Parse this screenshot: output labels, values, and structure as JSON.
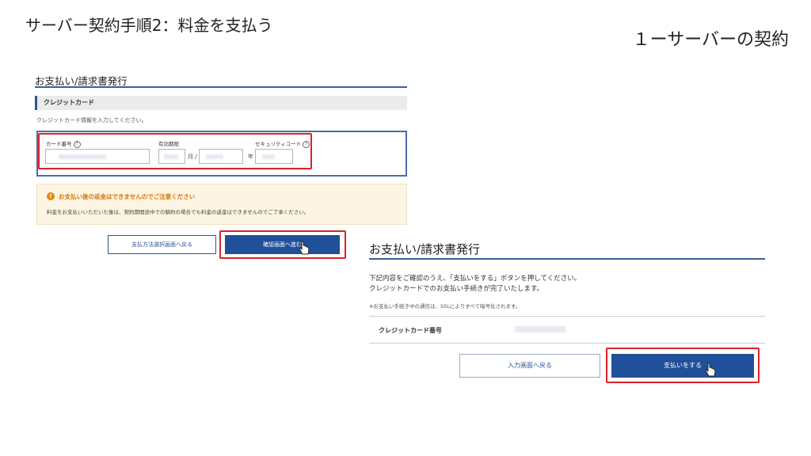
{
  "slide": {
    "title": "サーバー契約手順2：料金を支払う",
    "subtitle": "１ーサーバーの契約"
  },
  "step1": {
    "heading": "お支払い/請求書発行",
    "section": "クレジットカード",
    "note": "クレジットカード情報を入力してください。",
    "fields": {
      "card_number_label": "カード番号",
      "expiry_label": "有効期限",
      "month_unit": "月 /",
      "year_unit": "年",
      "security_code_label": "セキュリティコード",
      "help": "?"
    },
    "warning": {
      "icon": "!",
      "title": "お支払い後の返金はできませんのでご注意ください",
      "text": "料金をお支払いいただいた後は、契約期間途中での解約の場合でも料金の返金はできませんのでご了承ください。"
    },
    "back_button": "支払方法選択画面へ戻る",
    "next_button": "確認画面へ進む"
  },
  "step2": {
    "heading": "お支払い/請求書発行",
    "instruction_line1": "下記内容をご確認のうえ、「支払いをする」ボタンを押してください。",
    "instruction_line2": "クレジットカードでのお支払い手続きが完了いたします。",
    "ssl_note": "※お支払い手続き中の通信は、SSLによりすべて暗号化されます。",
    "card_label": "クレジットカード番号",
    "back_button": "入力画面へ戻る",
    "pay_button": "支払いをする"
  },
  "colors": {
    "accent": "#1f5099",
    "highlight": "#d9232b",
    "warning": "#e8850f"
  }
}
